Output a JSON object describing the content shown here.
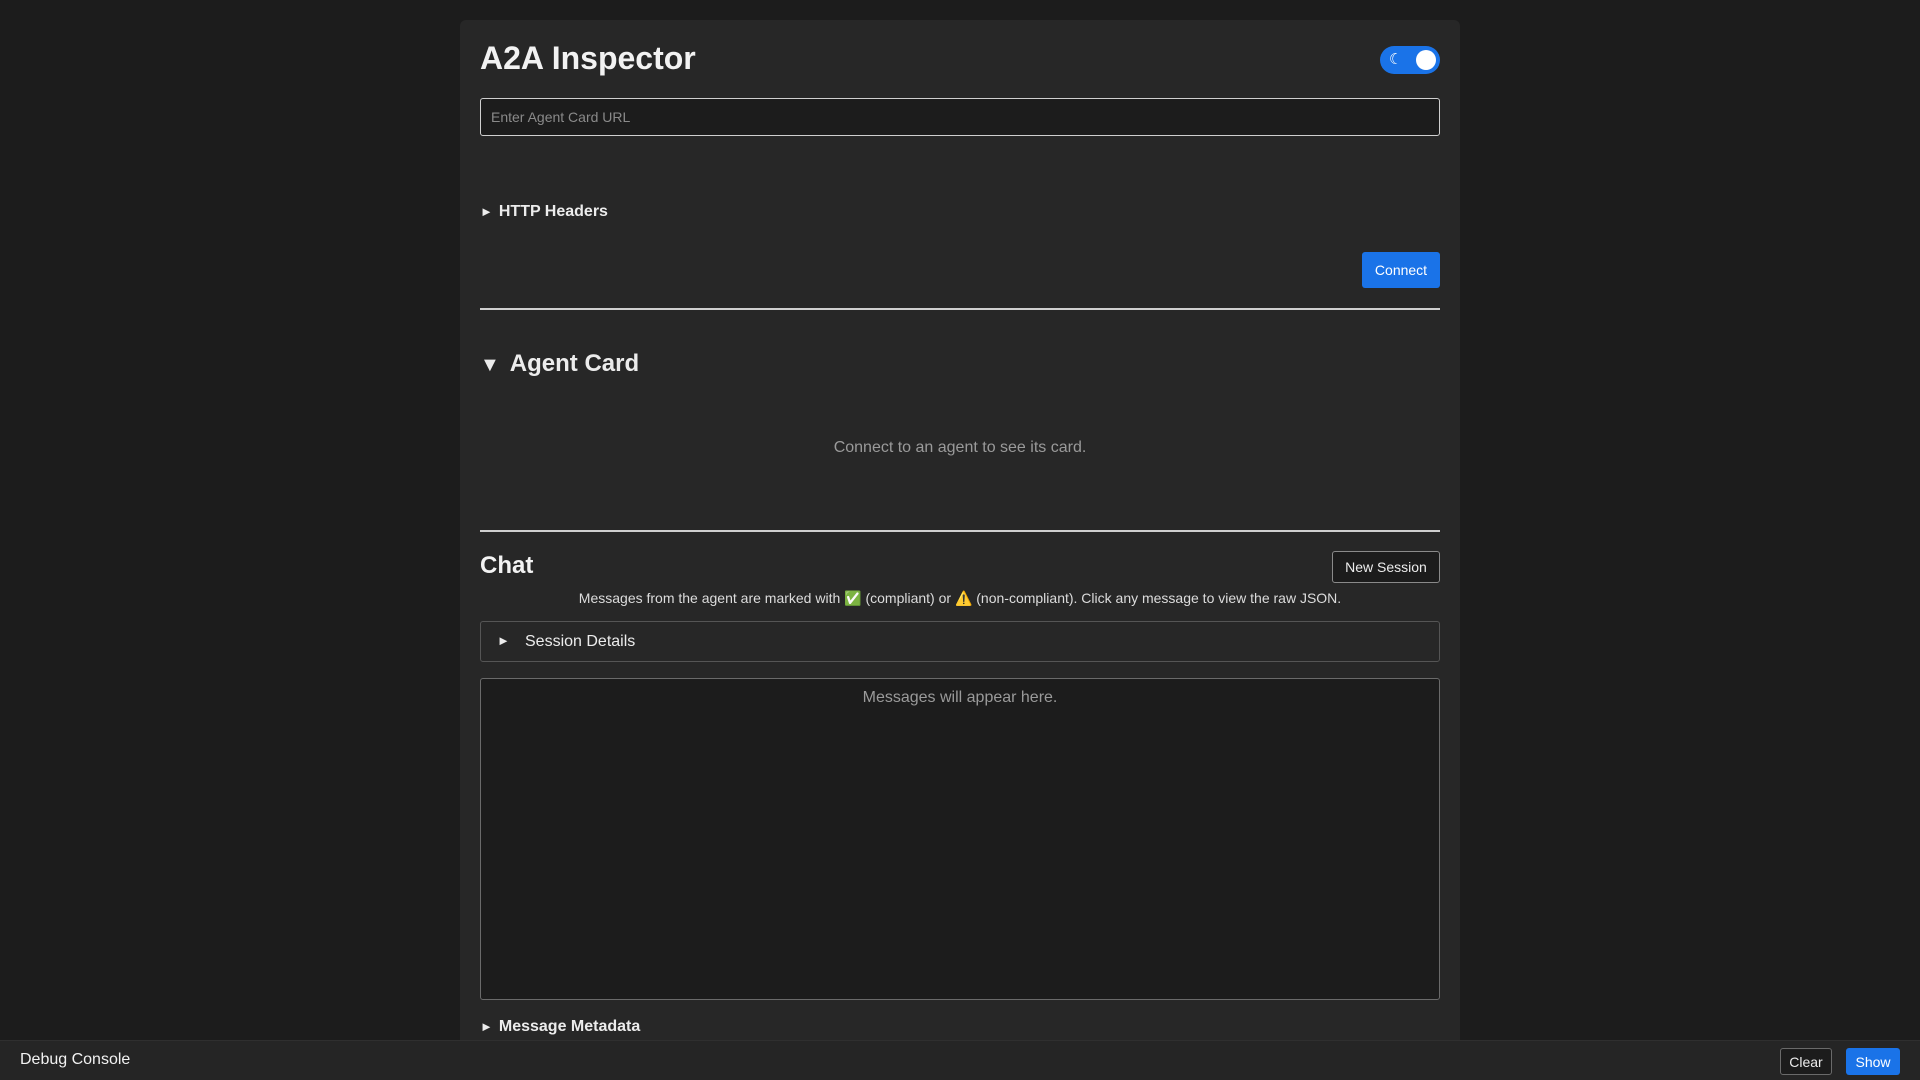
{
  "app": {
    "title": "A2A Inspector",
    "theme_toggle_icon": "☾"
  },
  "connection": {
    "url_placeholder": "Enter Agent Card URL",
    "url_value": "",
    "http_headers_arrow": "►",
    "http_headers_label": "HTTP Headers",
    "connect_label": "Connect"
  },
  "agent_card": {
    "arrow": "▼",
    "heading": "Agent Card",
    "placeholder": "Connect to an agent to see its card."
  },
  "chat": {
    "title": "Chat",
    "new_session_label": "New Session",
    "note_prefix": "Messages from the agent are marked with ",
    "compliant_icon": "✅",
    "note_middle": " (compliant) or ",
    "noncompliant_icon": "⚠️",
    "note_suffix": " (non-compliant). Click any message to view the raw JSON.",
    "session_details_arrow": "►",
    "session_details_label": "Session Details",
    "messages_placeholder": "Messages will appear here.",
    "metadata_arrow": "►",
    "metadata_label": "Message Metadata"
  },
  "debug_console": {
    "title": "Debug Console",
    "clear_label": "Clear",
    "show_label": "Show"
  },
  "colors": {
    "accent": "#1a73e8",
    "page_background": "#1c1c1c",
    "panel_background": "#272727"
  }
}
